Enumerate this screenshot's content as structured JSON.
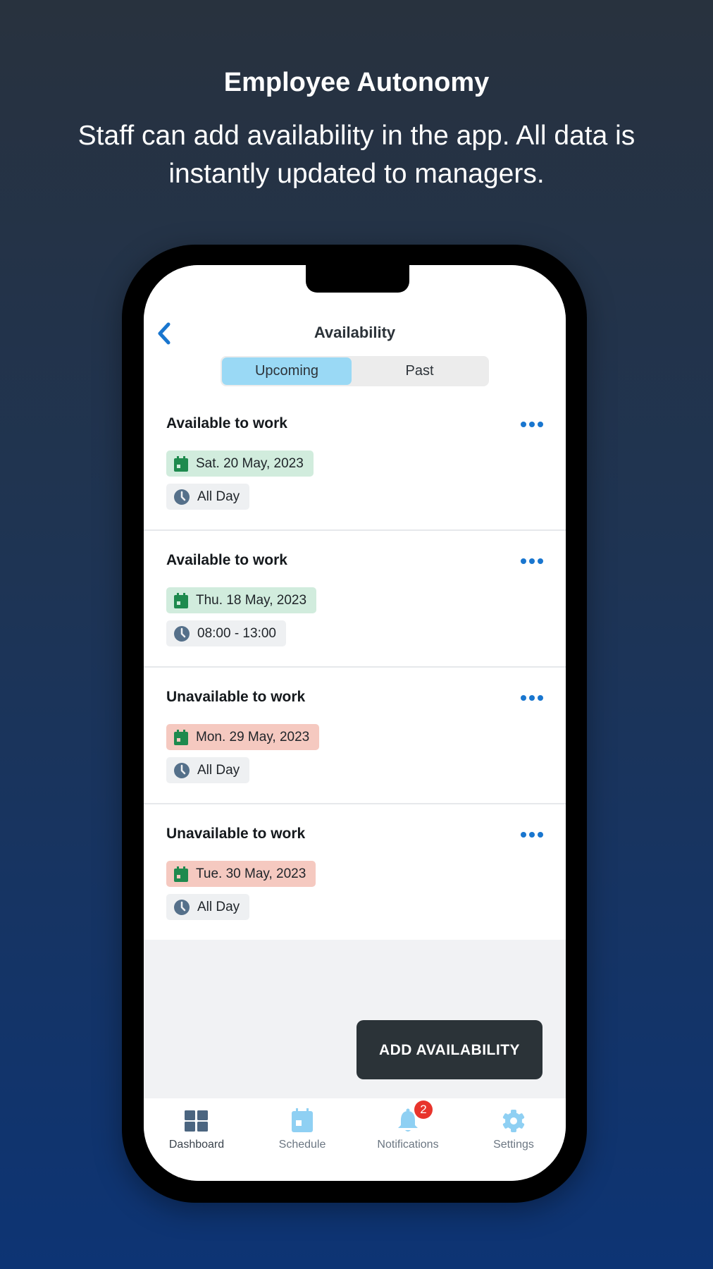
{
  "promo": {
    "headline": "Employee Autonomy",
    "subline": "Staff can add availability in the app. All data is instantly updated to managers."
  },
  "header": {
    "title": "Availability",
    "back_icon": "chevron-left-icon",
    "tabs": [
      {
        "label": "Upcoming",
        "active": true
      },
      {
        "label": "Past",
        "active": false
      }
    ]
  },
  "entries": [
    {
      "status": "Available to work",
      "date": "Sat. 20 May, 2023",
      "time": "All Day",
      "type": "available"
    },
    {
      "status": "Available to work",
      "date": "Thu. 18 May, 2023",
      "time": "08:00 - 13:00",
      "type": "available"
    },
    {
      "status": "Unavailable to work",
      "date": "Mon. 29 May, 2023",
      "time": "All Day",
      "type": "unavailable"
    },
    {
      "status": "Unavailable to work",
      "date": "Tue. 30 May, 2023",
      "time": "All Day",
      "type": "unavailable"
    }
  ],
  "actions": {
    "add_availability": "ADD AVAILABILITY"
  },
  "tabbar": {
    "items": [
      {
        "label": "Dashboard",
        "icon": "dashboard-grid-icon",
        "active": true
      },
      {
        "label": "Schedule",
        "icon": "calendar-icon",
        "active": false
      },
      {
        "label": "Notifications",
        "icon": "bell-icon",
        "active": false,
        "badge": "2"
      },
      {
        "label": "Settings",
        "icon": "gear-icon",
        "active": false
      }
    ]
  },
  "colors": {
    "accent_blue": "#1976cf",
    "segment_active": "#9ad9f5",
    "available_chip": "#d1ecdd",
    "unavailable_chip": "#f5c9c0",
    "calendar_icon": "#1e8a4e",
    "clock_icon": "#55708a",
    "badge_red": "#e8342c",
    "button_dark": "#2b3338"
  }
}
